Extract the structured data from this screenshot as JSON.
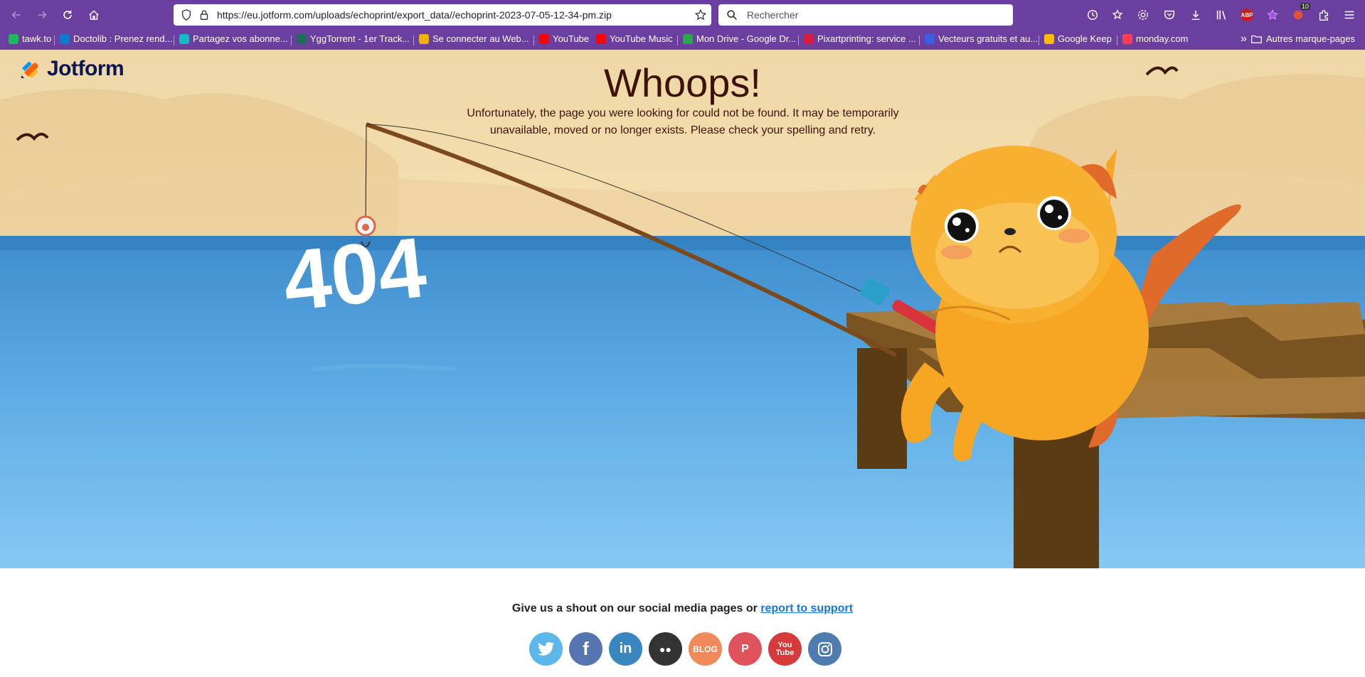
{
  "browser": {
    "url": "https://eu.jotform.com/uploads/echoprint/export_data//echoprint-2023-07-05-12-34-pm.zip",
    "search_placeholder": "Rechercher",
    "extension_badge": "10",
    "abp_label": "ABP"
  },
  "bookmarks": [
    {
      "label": "tawk.to",
      "color": "#1fb860"
    },
    {
      "label": "Doctolib : Prenez rend...",
      "color": "#107aca"
    },
    {
      "label": "Partagez vos abonne...",
      "color": "#19b9c4"
    },
    {
      "label": "YggTorrent - 1er Track...",
      "color": "#1d6d5a"
    },
    {
      "label": "Se connecter au Web...",
      "color": "#f0b400"
    },
    {
      "label": "YouTube",
      "color": "#ff0000"
    },
    {
      "label": "YouTube Music",
      "color": "#ff0000"
    },
    {
      "label": "Mon Drive - Google Dr...",
      "color": "#2ea44f"
    },
    {
      "label": "Pixartprinting: service ...",
      "color": "#d81b3a"
    },
    {
      "label": "Vecteurs gratuits et au...",
      "color": "#3b5fe0"
    },
    {
      "label": "Google Keep",
      "color": "#fbbc04"
    },
    {
      "label": "monday.com",
      "color": "#ff3d57"
    }
  ],
  "bookmarks_more": "Autres marque-pages",
  "page": {
    "logo_text": "Jotform",
    "headline": "Whoops!",
    "subtext": "Unfortunately, the page you were looking for could not be found. It may be temporarily unavailable, moved or no longer exists. Please check your spelling and retry.",
    "error_code": "404",
    "footer_text": "Give us a shout on our social media pages or ",
    "footer_link": "report to support"
  },
  "socials": [
    {
      "name": "twitter",
      "label": "",
      "color": "#5bb8e8"
    },
    {
      "name": "facebook",
      "label": "f",
      "color": "#5674b0"
    },
    {
      "name": "linkedin",
      "label": "in",
      "color": "#3a86c0"
    },
    {
      "name": "medium",
      "label": "●●",
      "color": "#333333"
    },
    {
      "name": "blog",
      "label": "BLOG",
      "color": "#f08a5d"
    },
    {
      "name": "pinterest",
      "label": "P",
      "color": "#e0535d"
    },
    {
      "name": "youtube",
      "label": "You Tube",
      "color": "#d63a3a"
    },
    {
      "name": "instagram",
      "label": "",
      "color": "#4e7cb0"
    }
  ],
  "colors": {
    "toolbar": "#6b3fa0",
    "sky": "#f3d9a2",
    "water": "#4a9fd8",
    "cat": "#f6a623",
    "headline": "#3d1209"
  }
}
